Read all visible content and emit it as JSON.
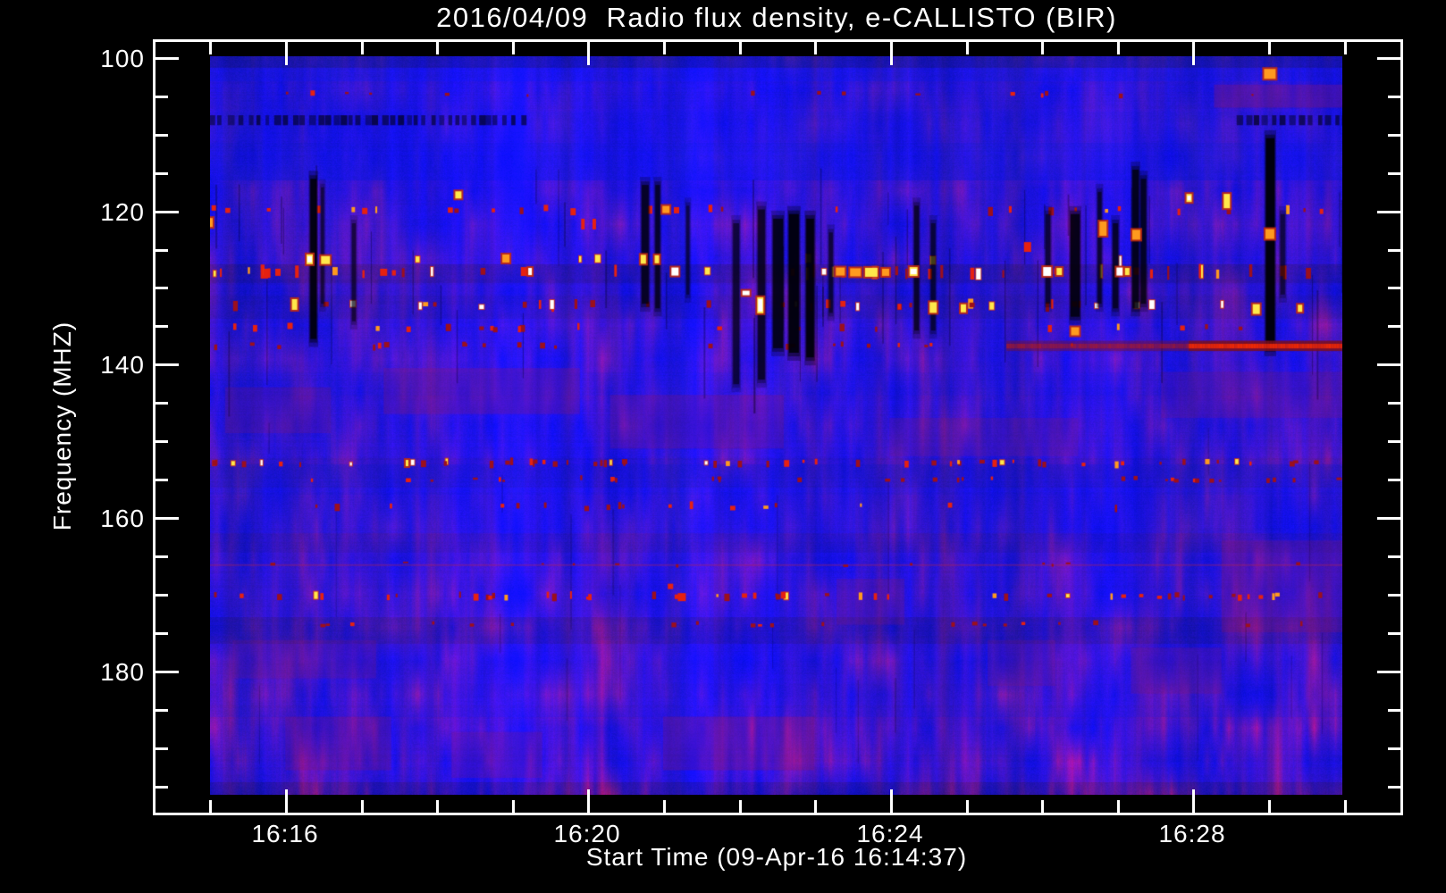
{
  "chart_data": {
    "type": "heatmap",
    "subtype": "radio-spectrogram",
    "title": "2016/04/09  Radio flux density, e-CALLISTO (BIR)",
    "xlabel": "Start Time (09-Apr-16 16:14:37)",
    "ylabel": "Frequency (MHZ)",
    "date": "2016/04/09",
    "start_time": "16:14:37",
    "instrument": "e-CALLISTO",
    "station": "BIR",
    "x_axis": {
      "unit": "time (UT)",
      "frame_range_min": [
        -0.75,
        15.75
      ],
      "data_range_min": [
        0,
        15
      ],
      "zero_time": "16:15",
      "major_ticks": [
        {
          "label": "16:16",
          "t": 1
        },
        {
          "label": "16:20",
          "t": 5
        },
        {
          "label": "16:24",
          "t": 9
        },
        {
          "label": "16:28",
          "t": 13
        }
      ],
      "minor_tick_every_min": 1
    },
    "y_axis": {
      "unit": "MHz",
      "frame_range_mhz": [
        97.7,
        198.5
      ],
      "data_range_mhz": [
        99.8,
        196.2
      ],
      "major_ticks": [
        100,
        120,
        140,
        160,
        180
      ],
      "minor_step_mhz": 5,
      "direction": "increasing-downward"
    },
    "palette": {
      "background": "#000000",
      "text": "#ffffff",
      "frame": "#ffffff",
      "base_blue": [
        26,
        18,
        232
      ],
      "mottle_purple": [
        150,
        20,
        90
      ],
      "dkred": "#9c101c",
      "red": "#e62110",
      "orange": "#ff9a1e",
      "yellow": "#ffe84a",
      "white": "#ffffff"
    },
    "features": {
      "seed": 20160409,
      "rfi_rows": [
        {
          "f": 104.8,
          "h": 4,
          "density": 0.9,
          "colors": [
            [
              "dkred",
              0.9
            ],
            [
              "red",
              0.1
            ]
          ]
        },
        {
          "f": 119.9,
          "h": 7,
          "density": 1.6,
          "colors": [
            [
              "dkred",
              0.45
            ],
            [
              "red",
              0.3
            ],
            [
              "orange",
              0.2
            ],
            [
              "yellow",
              0.05
            ]
          ]
        },
        {
          "f": 126.4,
          "h": 9,
          "density": 0.4,
          "colors": [
            [
              "yellow",
              0.4
            ],
            [
              "white",
              0.2
            ],
            [
              "orange",
              0.2
            ],
            [
              "red",
              0.2
            ]
          ]
        },
        {
          "f": 128.0,
          "h": 11,
          "density": 3.2,
          "colors": [
            [
              "red",
              0.45
            ],
            [
              "dkred",
              0.25
            ],
            [
              "orange",
              0.15
            ],
            [
              "yellow",
              0.1
            ],
            [
              "white",
              0.05
            ]
          ]
        },
        {
          "f": 132.3,
          "h": 8,
          "density": 2.4,
          "colors": [
            [
              "dkred",
              0.4
            ],
            [
              "red",
              0.25
            ],
            [
              "white",
              0.15
            ],
            [
              "yellow",
              0.1
            ],
            [
              "orange",
              0.1
            ]
          ]
        },
        {
          "f": 135.3,
          "h": 6,
          "density": 1.3,
          "colors": [
            [
              "dkred",
              0.6
            ],
            [
              "red",
              0.3
            ],
            [
              "orange",
              0.1
            ]
          ]
        },
        {
          "f": 137.6,
          "h": 5,
          "density": 1.5,
          "colors": [
            [
              "dkred",
              0.7
            ],
            [
              "red",
              0.3
            ]
          ]
        },
        {
          "f": 152.9,
          "h": 6,
          "density": 4.0,
          "colors": [
            [
              "dkred",
              0.55
            ],
            [
              "red",
              0.25
            ],
            [
              "orange",
              0.1
            ],
            [
              "white",
              0.06
            ],
            [
              "yellow",
              0.04
            ]
          ]
        },
        {
          "f": 155.0,
          "h": 4,
          "density": 2.2,
          "colors": [
            [
              "dkred",
              0.8
            ],
            [
              "red",
              0.2
            ]
          ]
        },
        {
          "f": 158.6,
          "h": 6,
          "density": 1.2,
          "colors": [
            [
              "dkred",
              0.7
            ],
            [
              "red",
              0.2
            ],
            [
              "orange",
              0.1
            ]
          ]
        },
        {
          "f": 166.1,
          "h": 3,
          "density": 0.8,
          "colors": [
            [
              "dkred",
              1.0
            ]
          ]
        },
        {
          "f": 170.3,
          "h": 6,
          "density": 3.4,
          "colors": [
            [
              "dkred",
              0.5
            ],
            [
              "red",
              0.3
            ],
            [
              "orange",
              0.15
            ],
            [
              "yellow",
              0.05
            ]
          ]
        },
        {
          "f": 173.9,
          "h": 4,
          "density": 1.4,
          "colors": [
            [
              "dkred",
              0.85
            ],
            [
              "red",
              0.15
            ]
          ]
        }
      ],
      "faint_line_f": 166.1,
      "dark_streaks": [
        [
          1.33,
          1.41,
          115.8,
          136.7,
          0.15
        ],
        [
          1.47,
          1.51,
          116.9,
          132.1,
          0.5
        ],
        [
          1.88,
          1.93,
          121.6,
          134.4,
          0.5
        ],
        [
          5.72,
          5.81,
          116.6,
          132.1,
          0.3
        ],
        [
          5.9,
          5.96,
          116.6,
          132.7,
          0.35
        ],
        [
          6.31,
          6.35,
          119.3,
          130.9,
          0.5
        ],
        [
          6.93,
          7.01,
          121.6,
          142.6,
          0.45
        ],
        [
          7.26,
          7.35,
          119.8,
          142.0,
          0.35
        ],
        [
          7.46,
          7.59,
          121.0,
          137.9,
          0.25
        ],
        [
          7.67,
          7.8,
          120.4,
          138.5,
          0.12
        ],
        [
          7.9,
          8.0,
          121.0,
          139.1,
          0.12
        ],
        [
          8.2,
          8.25,
          122.8,
          133.3,
          0.45
        ],
        [
          9.33,
          9.39,
          119.3,
          135.6,
          0.4
        ],
        [
          9.55,
          9.61,
          121.6,
          135.6,
          0.45
        ],
        [
          11.07,
          11.13,
          120.4,
          132.1,
          0.45
        ],
        [
          11.4,
          11.52,
          120.4,
          133.8,
          0.2
        ],
        [
          11.76,
          11.81,
          117.5,
          132.1,
          0.4
        ],
        [
          11.96,
          12.03,
          121.6,
          132.7,
          0.35
        ],
        [
          12.22,
          12.3,
          114.6,
          132.7,
          0.25
        ],
        [
          12.33,
          12.4,
          115.8,
          132.1,
          0.3
        ],
        [
          13.99,
          14.1,
          110.5,
          137.9,
          0.08
        ],
        [
          14.18,
          14.24,
          120.4,
          130.9,
          0.5
        ]
      ],
      "dark_dash_line": {
        "f0": 107.5,
        "f1": 108.8,
        "segments": [
          [
            0,
            4.2
          ],
          [
            13.6,
            15
          ]
        ]
      },
      "red_streak": {
        "t0": 10.55,
        "t_strong": 12.95,
        "t1": 15.0,
        "f": 137.6,
        "h_mhz": 1.35
      },
      "red_patches": [
        [
          2.3,
          4.9,
          140.5,
          146.5,
          0.25
        ],
        [
          0.2,
          1.6,
          143,
          149,
          0.2
        ],
        [
          5.3,
          7.6,
          144,
          151,
          0.22
        ],
        [
          9.0,
          11.5,
          147,
          152,
          0.18
        ],
        [
          12.6,
          15,
          141,
          147,
          0.2
        ],
        [
          6.0,
          8.0,
          186,
          193,
          0.25
        ],
        [
          1.0,
          2.4,
          186,
          193,
          0.22
        ],
        [
          3.2,
          4.4,
          188,
          194,
          0.2
        ],
        [
          12.2,
          13.4,
          177,
          183,
          0.2
        ],
        [
          0.3,
          2.2,
          176,
          181,
          0.18
        ],
        [
          8.3,
          9.2,
          168,
          174,
          0.2
        ],
        [
          13.4,
          15,
          163,
          175,
          0.22
        ],
        [
          10.3,
          11.2,
          176,
          182,
          0.18
        ],
        [
          13.3,
          15,
          103.5,
          106.5,
          0.3
        ]
      ],
      "blobs": [
        [
          0.0,
          121.5,
          6,
          10,
          "orange"
        ],
        [
          0.05,
          119.6,
          5,
          6,
          "red"
        ],
        [
          0.9,
          128.0,
          6,
          8,
          "red"
        ],
        [
          1.06,
          135.0,
          6,
          7,
          "red"
        ],
        [
          1.12,
          132.2,
          6,
          12,
          "yellow"
        ],
        [
          1.32,
          126.3,
          7,
          11,
          "bright"
        ],
        [
          1.36,
          104.6,
          5,
          6,
          "red"
        ],
        [
          1.53,
          126.4,
          10,
          9,
          "yellow"
        ],
        [
          2.05,
          120.0,
          6,
          7,
          "red"
        ],
        [
          2.3,
          128.0,
          8,
          8,
          "red"
        ],
        [
          2.61,
          152.9,
          3,
          7,
          "yellow"
        ],
        [
          3.29,
          117.9,
          7,
          8,
          "yellow"
        ],
        [
          3.92,
          126.2,
          8,
          9,
          "orange"
        ],
        [
          4.2,
          127.9,
          14,
          10,
          "red"
        ],
        [
          4.24,
          127.9,
          4,
          8,
          "white"
        ],
        [
          4.45,
          119.6,
          5,
          7,
          "red"
        ],
        [
          4.81,
          120.1,
          6,
          8,
          "red"
        ],
        [
          4.94,
          121.7,
          4,
          12,
          "red"
        ],
        [
          5.09,
          121.7,
          4,
          12,
          "red"
        ],
        [
          5.74,
          126.3,
          6,
          10,
          "yellow"
        ],
        [
          5.92,
          126.3,
          5,
          9,
          "yellow"
        ],
        [
          6.04,
          119.8,
          8,
          8,
          "orange"
        ],
        [
          6.18,
          119.9,
          6,
          7,
          "red"
        ],
        [
          6.16,
          127.9,
          8,
          9,
          "white"
        ],
        [
          6.25,
          170.4,
          9,
          9,
          "red"
        ],
        [
          6.1,
          169.0,
          6,
          6,
          "red"
        ],
        [
          7.1,
          130.7,
          8,
          5,
          "white"
        ],
        [
          7.29,
          132.3,
          7,
          18,
          "bright"
        ],
        [
          8.35,
          127.9,
          10,
          9,
          "orange"
        ],
        [
          8.55,
          128.0,
          12,
          9,
          "orange"
        ],
        [
          8.76,
          128.0,
          14,
          10,
          "yellow"
        ],
        [
          8.95,
          128.0,
          8,
          8,
          "orange"
        ],
        [
          9.32,
          127.9,
          9,
          10,
          "bright"
        ],
        [
          9.58,
          132.6,
          8,
          12,
          "yellow"
        ],
        [
          9.98,
          132.7,
          6,
          9,
          "yellow"
        ],
        [
          10.83,
          124.7,
          8,
          11,
          "red"
        ],
        [
          11.09,
          127.9,
          9,
          10,
          "white"
        ],
        [
          11.25,
          127.9,
          6,
          8,
          "yellow"
        ],
        [
          11.46,
          135.7,
          9,
          9,
          "orange"
        ],
        [
          11.83,
          122.3,
          8,
          16,
          "orange"
        ],
        [
          12.05,
          127.9,
          7,
          9,
          "white"
        ],
        [
          12.15,
          127.9,
          5,
          8,
          "yellow"
        ],
        [
          12.27,
          123.1,
          9,
          11,
          "orange"
        ],
        [
          12.97,
          118.3,
          6,
          9,
          "bright"
        ],
        [
          13.47,
          118.7,
          7,
          16,
          "yellow"
        ],
        [
          13.86,
          132.8,
          8,
          11,
          "yellow"
        ],
        [
          14.04,
          102.1,
          13,
          11,
          "orange"
        ],
        [
          14.04,
          123.0,
          10,
          11,
          "orange"
        ],
        [
          14.44,
          132.7,
          5,
          8,
          "yellow"
        ]
      ],
      "hairlines": {
        "count_active": 48,
        "f_range_active": [
          112,
          145
        ],
        "count_low": 22,
        "f_range_low": [
          146,
          196
        ]
      }
    }
  }
}
